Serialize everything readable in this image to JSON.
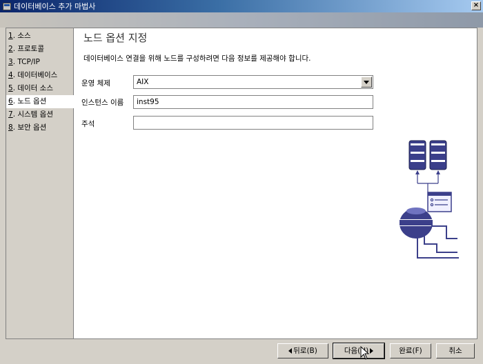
{
  "window": {
    "title": "데이터베이스 추가 마법사",
    "close_label": "×"
  },
  "sidebar": {
    "items": [
      {
        "num": "1",
        "label": ". 소스"
      },
      {
        "num": "2",
        "label": ". 프로토콜"
      },
      {
        "num": "3",
        "label": ". TCP/IP"
      },
      {
        "num": "4",
        "label": ". 데이터베이스"
      },
      {
        "num": "5",
        "label": ". 데이터 소스"
      },
      {
        "num": "6",
        "label": ". 노드 옵션"
      },
      {
        "num": "7",
        "label": ". 시스템 옵션"
      },
      {
        "num": "8",
        "label": ". 보안 옵션"
      }
    ],
    "active_index": 5
  },
  "main": {
    "heading": "노드 옵션 지정",
    "description": "데이터베이스 연결을 위해 노드를 구성하려면 다음 정보를 제공해야 합니다.",
    "os_label": "운영 체제",
    "os_value": "AIX",
    "instance_label": "인스턴스 이름",
    "instance_value": "inst95",
    "comment_label": "주석",
    "comment_value": ""
  },
  "footer": {
    "back_label": "뒤로(B)",
    "next_label": "다음(N)",
    "finish_label": "완료(F)",
    "cancel_label": "취소"
  },
  "colors": {
    "illustration": "#3b3f8a",
    "titlebar": "#0a246a"
  }
}
